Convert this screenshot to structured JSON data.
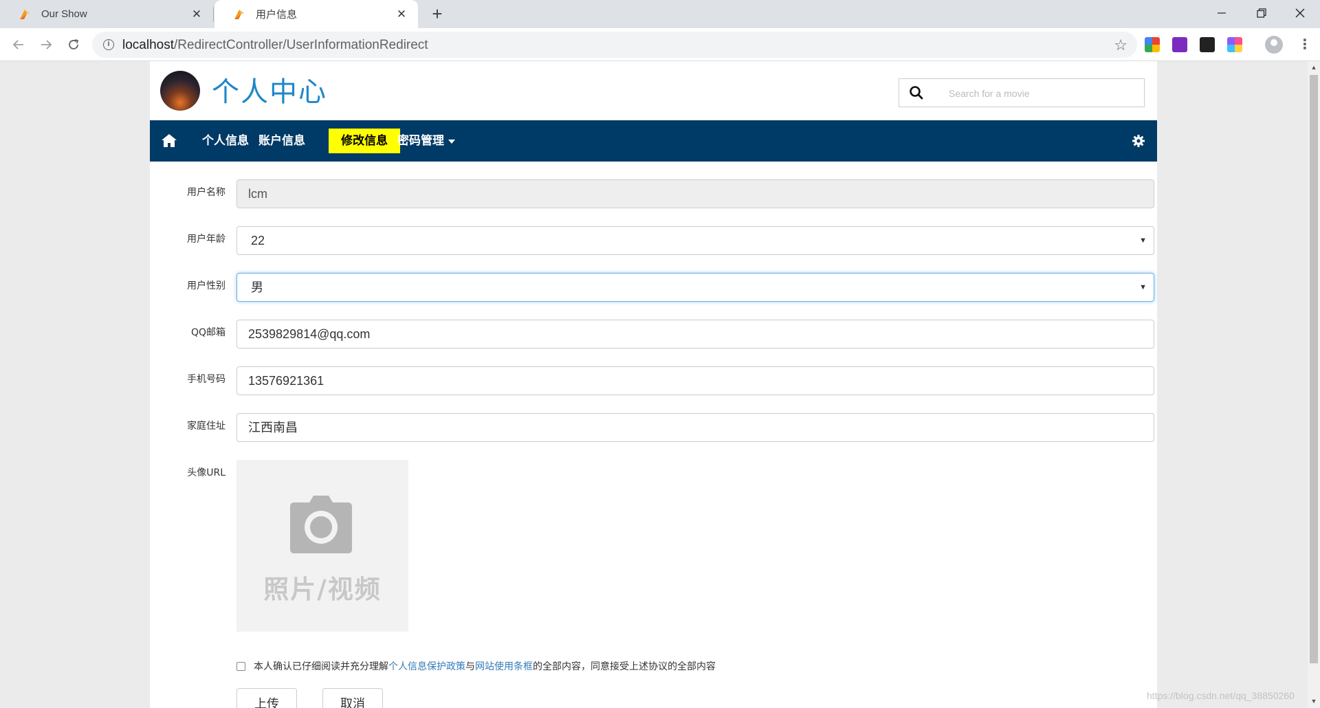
{
  "browser": {
    "tabs": [
      {
        "title": "Our Show",
        "active": false
      },
      {
        "title": "用户信息",
        "active": true
      }
    ],
    "url_host": "localhost",
    "url_path": "/RedirectController/UserInformationRedirect"
  },
  "header": {
    "title": "个人中心",
    "search_placeholder": "Search for a movie"
  },
  "nav": {
    "items": [
      {
        "label": "个人信息",
        "active": false
      },
      {
        "label": "账户信息",
        "active": false
      },
      {
        "label": "修改信息",
        "active": true
      },
      {
        "label": "密码管理",
        "active": false,
        "dropdown": true
      }
    ],
    "active_color": "#ffff00",
    "bar_color": "#003a66"
  },
  "form": {
    "username": {
      "label": "用户名称",
      "value": "lcm",
      "readonly": true
    },
    "age": {
      "label": "用户年龄",
      "value": "22"
    },
    "gender": {
      "label": "用户性别",
      "value": "男"
    },
    "email": {
      "label": "QQ邮箱",
      "value": "2539829814@qq.com"
    },
    "phone": {
      "label": "手机号码",
      "value": "13576921361"
    },
    "address": {
      "label": "家庭住址",
      "value": "江西南昌"
    },
    "avatar": {
      "label": "头像URL",
      "placeholder_text": "照片/视频"
    },
    "agreement": {
      "prefix": "本人确认已仔细阅读并充分理解",
      "link1": "个人信息保护政策",
      "middle": "与",
      "link2": "网站使用条框",
      "suffix": "的全部内容，同意接受上述协议的全部内容",
      "checked": false
    },
    "upload_label": "上传",
    "cancel_label": "取消"
  },
  "watermark": "https://blog.csdn.net/qq_38850260"
}
